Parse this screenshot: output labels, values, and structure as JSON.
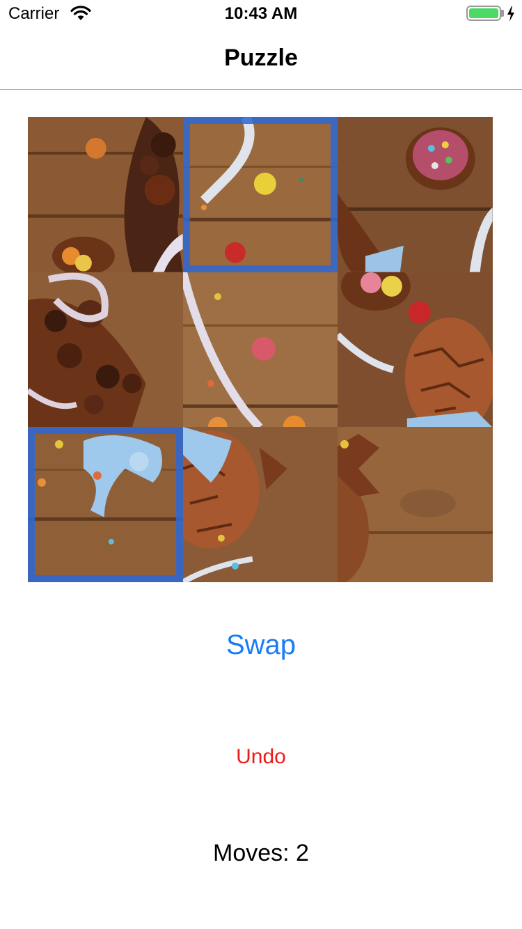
{
  "status_bar": {
    "carrier": "Carrier",
    "time": "10:43 AM",
    "battery_level": 1.0,
    "battery_color": "#4cd964",
    "charging": true
  },
  "nav": {
    "title": "Puzzle"
  },
  "puzzle": {
    "rows": 3,
    "columns": 3,
    "selected_tiles": [
      2,
      7
    ],
    "selection_color": "#2b67d7"
  },
  "actions": {
    "swap_label": "Swap",
    "swap_color": "#1a7cf3",
    "undo_label": "Undo",
    "undo_color": "#ee1b1b"
  },
  "moves": {
    "text": "Moves: 2"
  }
}
